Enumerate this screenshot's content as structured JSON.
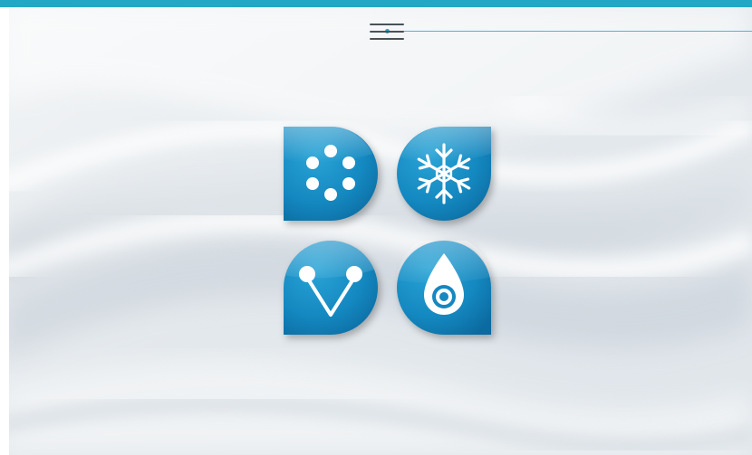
{
  "window": {
    "accent_color": "#23a8c3"
  },
  "header": {
    "menu_icon": "hamburger-menu-icon"
  },
  "tiles": [
    {
      "icon": "dots-ring-icon"
    },
    {
      "icon": "snowflake-icon"
    },
    {
      "icon": "v-connector-icon"
    },
    {
      "icon": "water-drop-target-icon"
    }
  ],
  "colors": {
    "tile_dark": "#0b73a8",
    "tile_light": "#2aa4d6",
    "icon": "#ffffff"
  }
}
